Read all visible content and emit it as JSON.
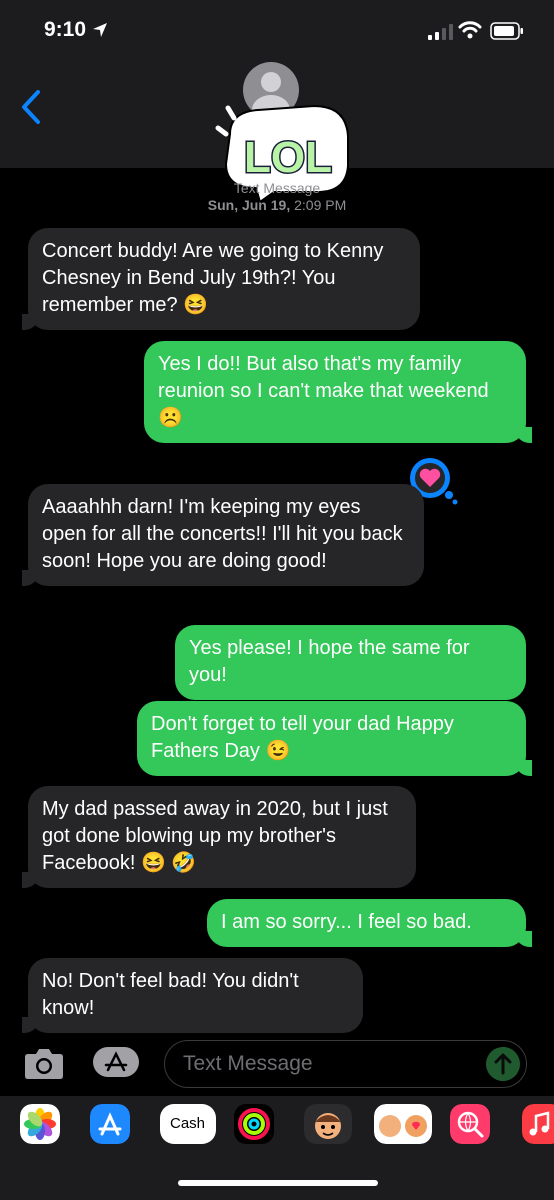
{
  "status_bar": {
    "time": "9:10"
  },
  "header": {
    "sticker_text": "LOL"
  },
  "thread": {
    "service": "Text Message",
    "date": "Sun, Jun 19,",
    "time": "2:09 PM"
  },
  "messages": [
    {
      "dir": "in",
      "text": "Concert buddy! Are we going to Kenny Chesney in Bend July 19th?! You remember me? 😆"
    },
    {
      "dir": "out",
      "text": "Yes I do!! But also that's my family reunion so I can't make that weekend ☹️"
    },
    {
      "dir": "in",
      "text": "Aaaahhh darn! I'm keeping my eyes open for all the concerts!! I'll hit you back soon! Hope you are doing good!"
    },
    {
      "dir": "out",
      "text": "Yes please! I hope the same for you!"
    },
    {
      "dir": "out",
      "text": "Don't forget to tell your dad Happy Fathers Day 😉"
    },
    {
      "dir": "in",
      "text": "My dad passed away in 2020, but I just got done blowing up my brother's Facebook! 😆 🤣"
    },
    {
      "dir": "out",
      "text": "I am so sorry... I feel so bad."
    },
    {
      "dir": "in",
      "text": "No! Don't feel bad! You didn't know!"
    }
  ],
  "tapback": {
    "icon": "heart-icon",
    "color": "#ff4fa0"
  },
  "composer": {
    "placeholder": "Text Message"
  },
  "app_drawer": {
    "apple_cash_label": "Cash"
  },
  "colors": {
    "outgoing": "#34c759",
    "incoming": "#262628",
    "accent": "#0a84ff"
  }
}
